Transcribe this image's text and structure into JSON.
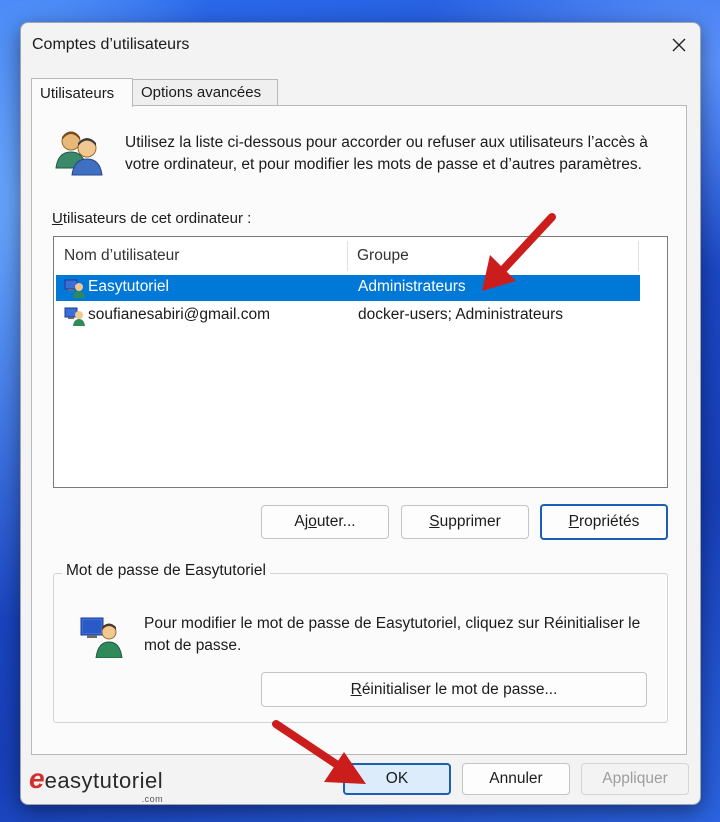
{
  "window": {
    "title": "Comptes d’utilisateurs"
  },
  "tabs": [
    {
      "label": "Utilisateurs",
      "active": true
    },
    {
      "label": "Options avancées",
      "active": false
    }
  ],
  "intro": {
    "text": "Utilisez la liste ci-dessous pour accorder ou refuser aux utilisateurs l’accès à votre ordinateur, et pour modifier les mots de passe et d’autres paramètres."
  },
  "users_section": {
    "label_first": "U",
    "label_rest": "tilisateurs de cet ordinateur :"
  },
  "table": {
    "columns": [
      "Nom d’utilisateur",
      "Groupe"
    ],
    "rows": [
      {
        "name": "Easytutoriel",
        "group": "Administrateurs",
        "selected": true
      },
      {
        "name": "soufianesabiri@gmail.com",
        "group": "docker-users; Administrateurs",
        "selected": false
      }
    ]
  },
  "actions": {
    "add": {
      "pre": "Aj",
      "ul": "o",
      "post": "uter..."
    },
    "remove": {
      "pre": "",
      "ul": "S",
      "post": "upprimer"
    },
    "properties": {
      "pre": "",
      "ul": "P",
      "post": "ropriétés"
    }
  },
  "password": {
    "title": "Mot de passe de Easytutoriel",
    "text": "Pour modifier le mot de passe de Easytutoriel, cliquez sur Réinitialiser le mot de passe.",
    "reset": {
      "pre": "",
      "ul": "R",
      "post": "éinitialiser le mot de passe..."
    }
  },
  "footer": {
    "ok": "OK",
    "cancel": "Annuler",
    "apply": "Appliquer"
  },
  "watermark": {
    "e": "e",
    "text": "easytutoriel",
    "com": ".com"
  },
  "colors": {
    "selection": "#0078d7",
    "arrow": "#cc1d1d",
    "accent": "#1a5fb4"
  }
}
